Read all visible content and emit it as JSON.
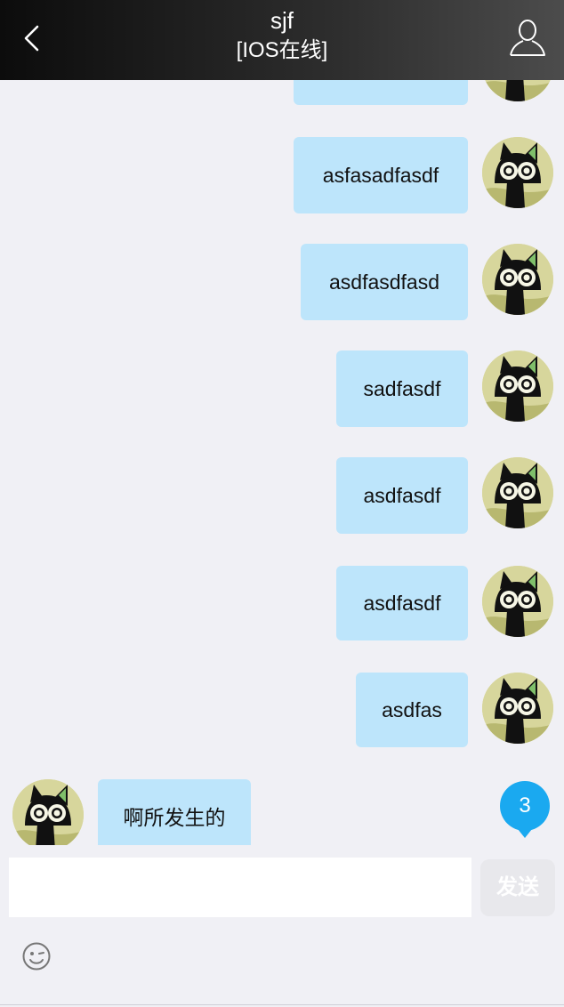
{
  "header": {
    "title": "sjf",
    "subtitle": "[IOS在线]"
  },
  "messages": [
    {
      "side": "right",
      "text": ""
    },
    {
      "side": "right",
      "text": "asfasadfasdf"
    },
    {
      "side": "right",
      "text": "asdfasdfasd"
    },
    {
      "side": "right",
      "text": "sadfasdf"
    },
    {
      "side": "right",
      "text": "asdfasdf"
    },
    {
      "side": "right",
      "text": "asdfasdf"
    },
    {
      "side": "right",
      "text": "asdfas"
    },
    {
      "side": "left",
      "text": "啊所发生的"
    }
  ],
  "unread_badge": "3",
  "composer": {
    "input_value": "",
    "placeholder": "",
    "send_label": "发送"
  },
  "colors": {
    "bubble": "#bde5fb",
    "badge": "#1aa9f0",
    "background": "#f0f0f5"
  },
  "icons": [
    "back-icon",
    "user-profile-icon",
    "emoji-icon"
  ]
}
